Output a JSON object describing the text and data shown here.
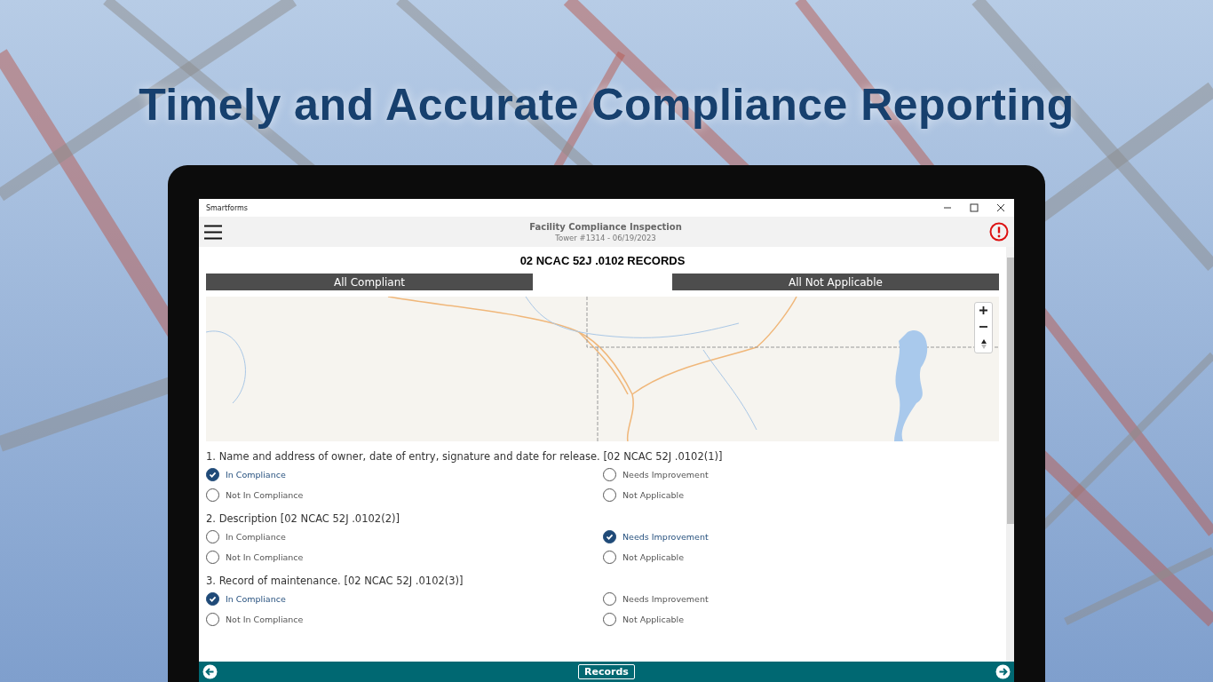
{
  "headline": "Timely and Accurate Compliance Reporting",
  "window": {
    "title": "Smartforms"
  },
  "header": {
    "title": "Facility Compliance Inspection",
    "subtitle": "Tower #1314 - 06/19/2023"
  },
  "section": {
    "title": "02 NCAC 52J .0102 RECORDS"
  },
  "bulk_buttons": [
    "All Compliant",
    "All Not Applicable"
  ],
  "questions": [
    {
      "text": "1. Name and address of owner, date of entry, signature and date for release. [02 NCAC 52J .0102(1)]",
      "options": [
        {
          "label": "In Compliance",
          "selected": true
        },
        {
          "label": "Needs Improvement",
          "selected": false
        },
        {
          "label": "Not In Compliance",
          "selected": false
        },
        {
          "label": "Not Applicable",
          "selected": false
        }
      ]
    },
    {
      "text": "2. Description [02 NCAC 52J .0102(2)]",
      "options": [
        {
          "label": "In Compliance",
          "selected": false
        },
        {
          "label": "Needs Improvement",
          "selected": true
        },
        {
          "label": "Not In Compliance",
          "selected": false
        },
        {
          "label": "Not Applicable",
          "selected": false
        }
      ]
    },
    {
      "text": "3. Record of maintenance. [02 NCAC 52J .0102(3)]",
      "options": [
        {
          "label": "In Compliance",
          "selected": true
        },
        {
          "label": "Needs Improvement",
          "selected": false
        },
        {
          "label": "Not In Compliance",
          "selected": false
        },
        {
          "label": "Not Applicable",
          "selected": false
        }
      ]
    }
  ],
  "footer": {
    "button": "Records"
  }
}
